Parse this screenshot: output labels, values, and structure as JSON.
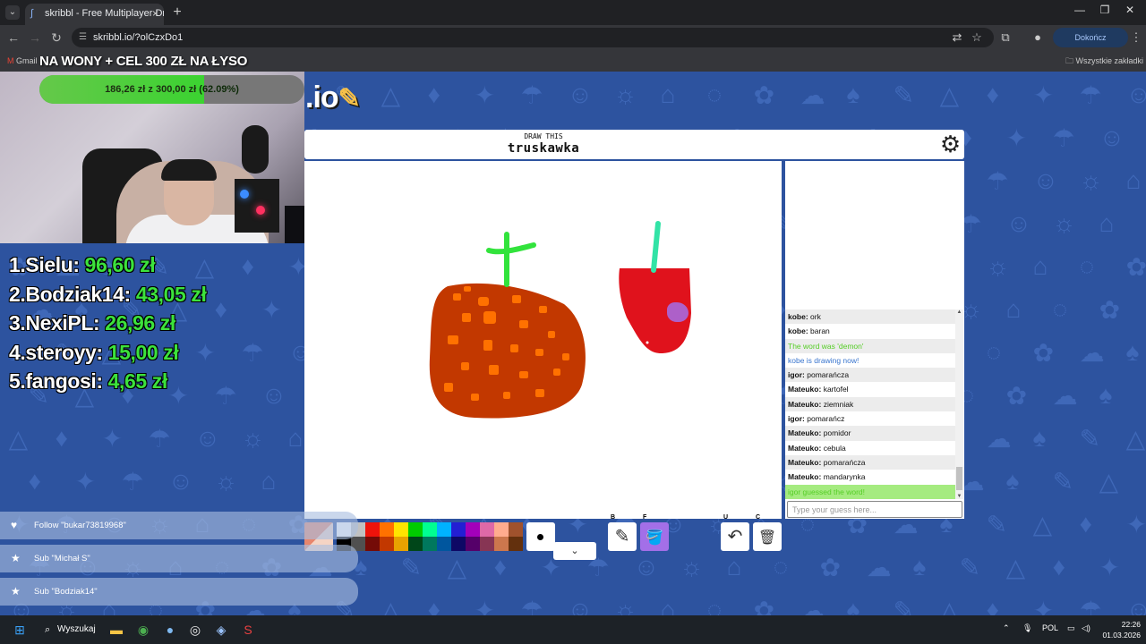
{
  "browser": {
    "tab_title": "skribbl - Free Multiplayer Drawi",
    "url": "skribbl.io/?olCzxDo1",
    "update_button": "Dokończ aktualizację",
    "bookmarks_left": "Gmail",
    "bookmarks_right": "Wszystkie zakładki"
  },
  "overlay": {
    "donation_title": "NA WONY + CEL 300 ZŁ NA ŁYSO",
    "goal": {
      "current": "186,26 zł",
      "sep": "z",
      "target": "300,00 zł",
      "percent_label": "(62.09%)",
      "percent": 62.09
    },
    "leaderboard": [
      {
        "rank": "1.",
        "name": "Sielu:",
        "amount": "96,60 zł"
      },
      {
        "rank": "2.",
        "name": "Bodziak14:",
        "amount": "43,05 zł"
      },
      {
        "rank": "3.",
        "name": "NexiPL:",
        "amount": "26,96 zł"
      },
      {
        "rank": "4.",
        "name": "steroyy:",
        "amount": "15,00 zł"
      },
      {
        "rank": "5.",
        "name": "fangosi:",
        "amount": "4,65 zł"
      }
    ],
    "events": [
      {
        "icon": "heart-icon",
        "text": "Follow \"bukar73819968\""
      },
      {
        "icon": "star-icon",
        "text": "Sub \"Michał S\""
      },
      {
        "icon": "star-icon",
        "text": "Sub \"Bodziak14\""
      }
    ]
  },
  "game": {
    "logo": ".io",
    "draw_this_label": "DRAW THIS",
    "word": "truskawka",
    "chat": [
      {
        "name": "kobe:",
        "msg": "ork",
        "style": "alt"
      },
      {
        "name": "kobe:",
        "msg": "baran",
        "style": ""
      },
      {
        "name": "",
        "msg": "The word was 'demon'",
        "style": "alt green"
      },
      {
        "name": "",
        "msg": "kobe is drawing now!",
        "style": "blue"
      },
      {
        "name": "igor:",
        "msg": "pomarańcza",
        "style": "alt"
      },
      {
        "name": "Mateuko:",
        "msg": "kartofel",
        "style": ""
      },
      {
        "name": "Mateuko:",
        "msg": "ziemniak",
        "style": "alt"
      },
      {
        "name": "igor:",
        "msg": "pomarańcz",
        "style": ""
      },
      {
        "name": "Mateuko:",
        "msg": "pomidor",
        "style": "alt"
      },
      {
        "name": "Mateuko:",
        "msg": "cebula",
        "style": ""
      },
      {
        "name": "Mateuko:",
        "msg": "pomarańcza",
        "style": "alt"
      },
      {
        "name": "Mateuko:",
        "msg": "mandarynka",
        "style": ""
      },
      {
        "name": "",
        "msg": "igor guessed the word!",
        "style": "greenbg"
      }
    ],
    "guess_placeholder": "Type your guess here...",
    "palette": {
      "top": [
        "#ffffff",
        "#c1c1c1",
        "#ef130b",
        "#ff7100",
        "#ffe400",
        "#00cc00",
        "#00ff91",
        "#00b2ff",
        "#231fd3",
        "#a300ba",
        "#df69a7",
        "#ffac8e",
        "#a0522d"
      ],
      "bottom": [
        "#000000",
        "#505050",
        "#740b07",
        "#c23800",
        "#e8a200",
        "#004619",
        "#00785d",
        "#00569e",
        "#0e0865",
        "#550069",
        "#873554",
        "#cc774d",
        "#63300d"
      ]
    },
    "tools": [
      {
        "key": "B",
        "name": "brush-tool",
        "icon": "✎"
      },
      {
        "key": "F",
        "name": "fill-tool",
        "icon": "🪣"
      },
      {
        "key": "U",
        "name": "undo-tool",
        "icon": "↶"
      },
      {
        "key": "C",
        "name": "clear-tool",
        "icon": "🗑"
      }
    ]
  },
  "taskbar": {
    "search": "Wyszukaj",
    "lang": "POL",
    "time": "22:26",
    "date": "01.03.2026"
  }
}
